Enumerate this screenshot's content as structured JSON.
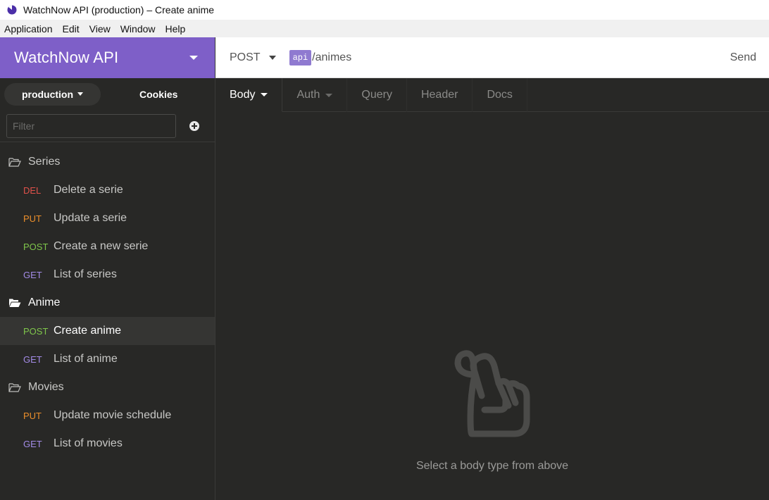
{
  "window": {
    "title": "WatchNow API (production) – Create anime"
  },
  "menubar": [
    "Application",
    "Edit",
    "View",
    "Window",
    "Help"
  ],
  "sidebar": {
    "workspace_name": "WatchNow API",
    "environment": "production",
    "cookies_label": "Cookies",
    "filter_placeholder": "Filter",
    "folders": [
      {
        "name": "Series",
        "open": false,
        "requests": [
          {
            "method": "DEL",
            "name": "Delete a serie"
          },
          {
            "method": "PUT",
            "name": "Update a serie"
          },
          {
            "method": "POST",
            "name": "Create a new serie"
          },
          {
            "method": "GET",
            "name": "List of series"
          }
        ]
      },
      {
        "name": "Anime",
        "open": true,
        "requests": [
          {
            "method": "POST",
            "name": "Create anime",
            "active": true
          },
          {
            "method": "GET",
            "name": "List of anime"
          }
        ]
      },
      {
        "name": "Movies",
        "open": false,
        "requests": [
          {
            "method": "PUT",
            "name": "Update movie schedule"
          },
          {
            "method": "GET",
            "name": "List of movies"
          }
        ]
      }
    ]
  },
  "request": {
    "method": "POST",
    "url_prefix": "api",
    "url_path": "/animes",
    "send_label": "Send"
  },
  "tabs": [
    "Body",
    "Auth",
    "Query",
    "Header",
    "Docs"
  ],
  "body": {
    "empty_text": "Select a body type from above"
  },
  "colors": {
    "accent": "#7e5fc8",
    "sidebar_bg": "#282826",
    "method_del": "#e0514a",
    "method_put": "#ec8f2b",
    "method_post": "#7fc64b",
    "method_get": "#a38be6"
  }
}
